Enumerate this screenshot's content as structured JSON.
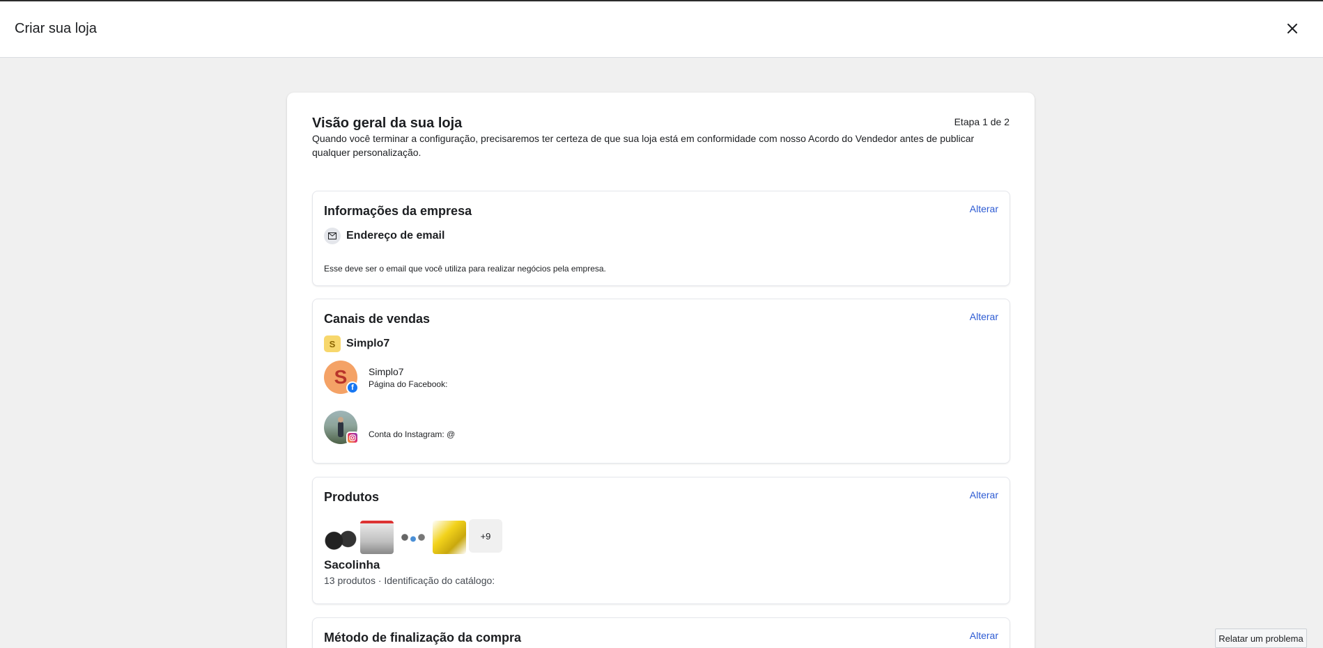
{
  "header": {
    "title": "Criar sua loja",
    "close_icon": "close-icon"
  },
  "overview": {
    "title": "Visão geral da sua loja",
    "step": "Etapa 1 de 2",
    "description": "Quando você terminar a configuração, precisaremos ter certeza de que sua loja está em conformidade com nosso Acordo do Vendedor antes de publicar qualquer personalização."
  },
  "business_info": {
    "title": "Informações da empresa",
    "change_label": "Alterar",
    "email_icon": "envelope-icon",
    "email_label": "Endereço de email",
    "email_hint": "Esse deve ser o email que você utiliza para realizar negócios pela empresa."
  },
  "sales_channels": {
    "title": "Canais de vendas",
    "change_label": "Alterar",
    "shop_badge": "S",
    "shop_name": "Simplo7",
    "facebook": {
      "avatar_letter": "S",
      "name": "Simplo7",
      "label": "Página do Facebook:",
      "badge_icon": "facebook-icon"
    },
    "instagram": {
      "label": "Conta do Instagram: @",
      "badge_icon": "instagram-icon"
    }
  },
  "products": {
    "title": "Produtos",
    "change_label": "Alterar",
    "more_count": "+9",
    "catalog_name": "Sacolinha",
    "catalog_info": "13 produtos · Identificação do catálogo:"
  },
  "checkout": {
    "title": "Método de finalização da compra",
    "change_label": "Alterar"
  },
  "footer": {
    "report_label": "Relatar um problema"
  },
  "colors": {
    "link": "#2d5bd3",
    "background": "#f0f0f0",
    "facebook": "#1877f2"
  }
}
